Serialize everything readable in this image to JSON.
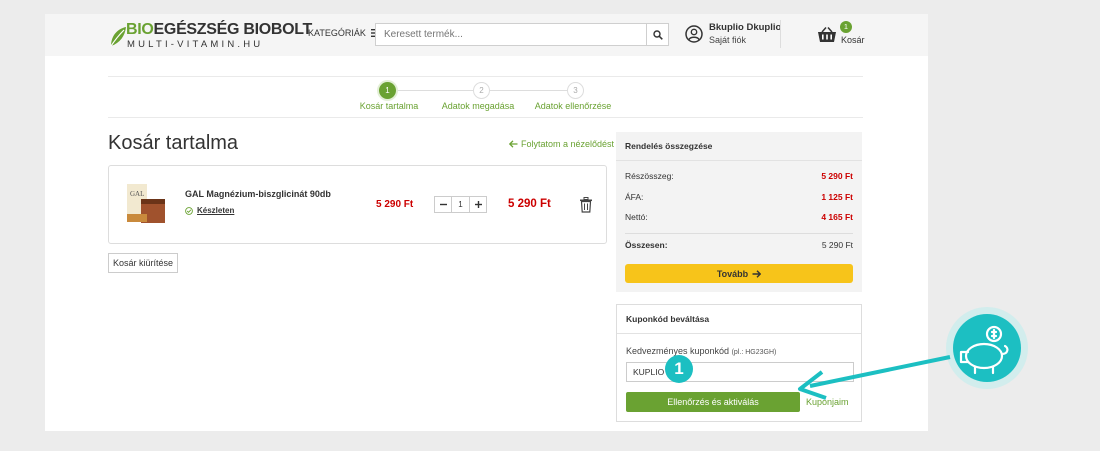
{
  "header": {
    "logo_line1": "EGÉSZSÉG BIOBOLT",
    "logo_bio": "BIO",
    "logo_line2": "MULTI-VITAMIN.HU",
    "categories_label": "KATEGÓRIÁK",
    "search_placeholder": "Keresett termék...",
    "account_name": "Bkuplio Dkuplio",
    "account_sub": "Saját fiók",
    "cart_count": "1",
    "cart_label": "Kosár"
  },
  "steps": [
    {
      "number": "1",
      "label": "Kosár tartalma"
    },
    {
      "number": "2",
      "label": "Adatok megadása"
    },
    {
      "number": "3",
      "label": "Adatok ellenőrzése"
    }
  ],
  "cart": {
    "title": "Kosár tartalma",
    "continue_label": "Folytatom a nézelődést",
    "clear_label": "Kosár kiürítése",
    "item": {
      "name": "GAL Magnézium-biszglicinát 90db",
      "stock": "Készleten",
      "unit_price": "5 290 Ft",
      "quantity": "1",
      "total_price": "5 290 Ft"
    }
  },
  "summary": {
    "heading": "Rendelés összegzése",
    "rows": [
      {
        "label": "Részösszeg:",
        "value": "5 290 Ft"
      },
      {
        "label": "ÁFA:",
        "value": "1 125 Ft"
      },
      {
        "label": "Nettó:",
        "value": "4 165 Ft"
      }
    ],
    "total_label": "Összesen:",
    "total_value": "5 290 Ft",
    "next_label": "Tovább"
  },
  "coupon": {
    "heading": "Kuponkód beváltása",
    "field_label": "Kedvezményes kuponkód",
    "field_hint": "(pl.: HG23GH)",
    "field_value": "KUPLIO",
    "validate_label": "Ellenőrzés és aktiválás",
    "my_coupons_label": "Kuponjaim"
  },
  "annotation": {
    "step_number": "1",
    "icon": "piggy-bank-icon"
  },
  "colors": {
    "brand_green": "#6aa232",
    "price_red": "#cc0000",
    "cta_yellow": "#f7c41a",
    "annotation_teal": "#1cbfc2"
  }
}
